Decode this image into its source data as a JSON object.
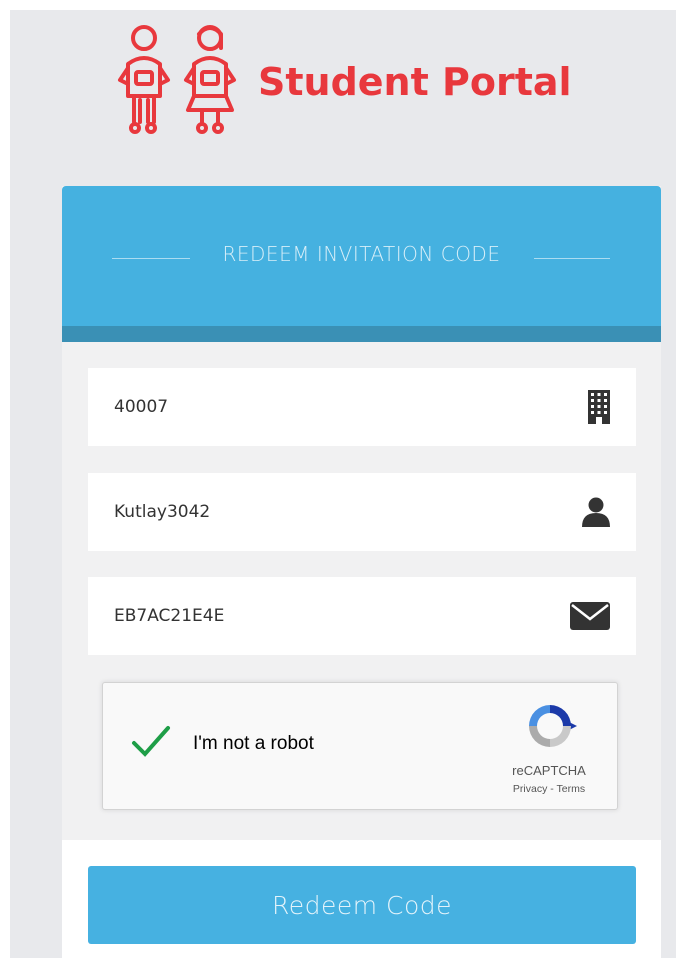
{
  "brand": {
    "title": "Student Portal",
    "logo_icon": "students-icon",
    "accent_color": "#e8383d"
  },
  "form": {
    "header_title": "REDEEM INVITATION CODE",
    "header_color": "#45b1e0",
    "fields": [
      {
        "value": "40007",
        "icon": "building-icon"
      },
      {
        "value": "Kutlay3042",
        "icon": "user-icon"
      },
      {
        "value": "EB7AC21E4E",
        "icon": "envelope-icon"
      }
    ],
    "captcha": {
      "label": "I'm not a robot",
      "checked": true,
      "brand": "reCAPTCHA",
      "links": "Privacy - Terms"
    },
    "submit_label": "Redeem Code"
  }
}
